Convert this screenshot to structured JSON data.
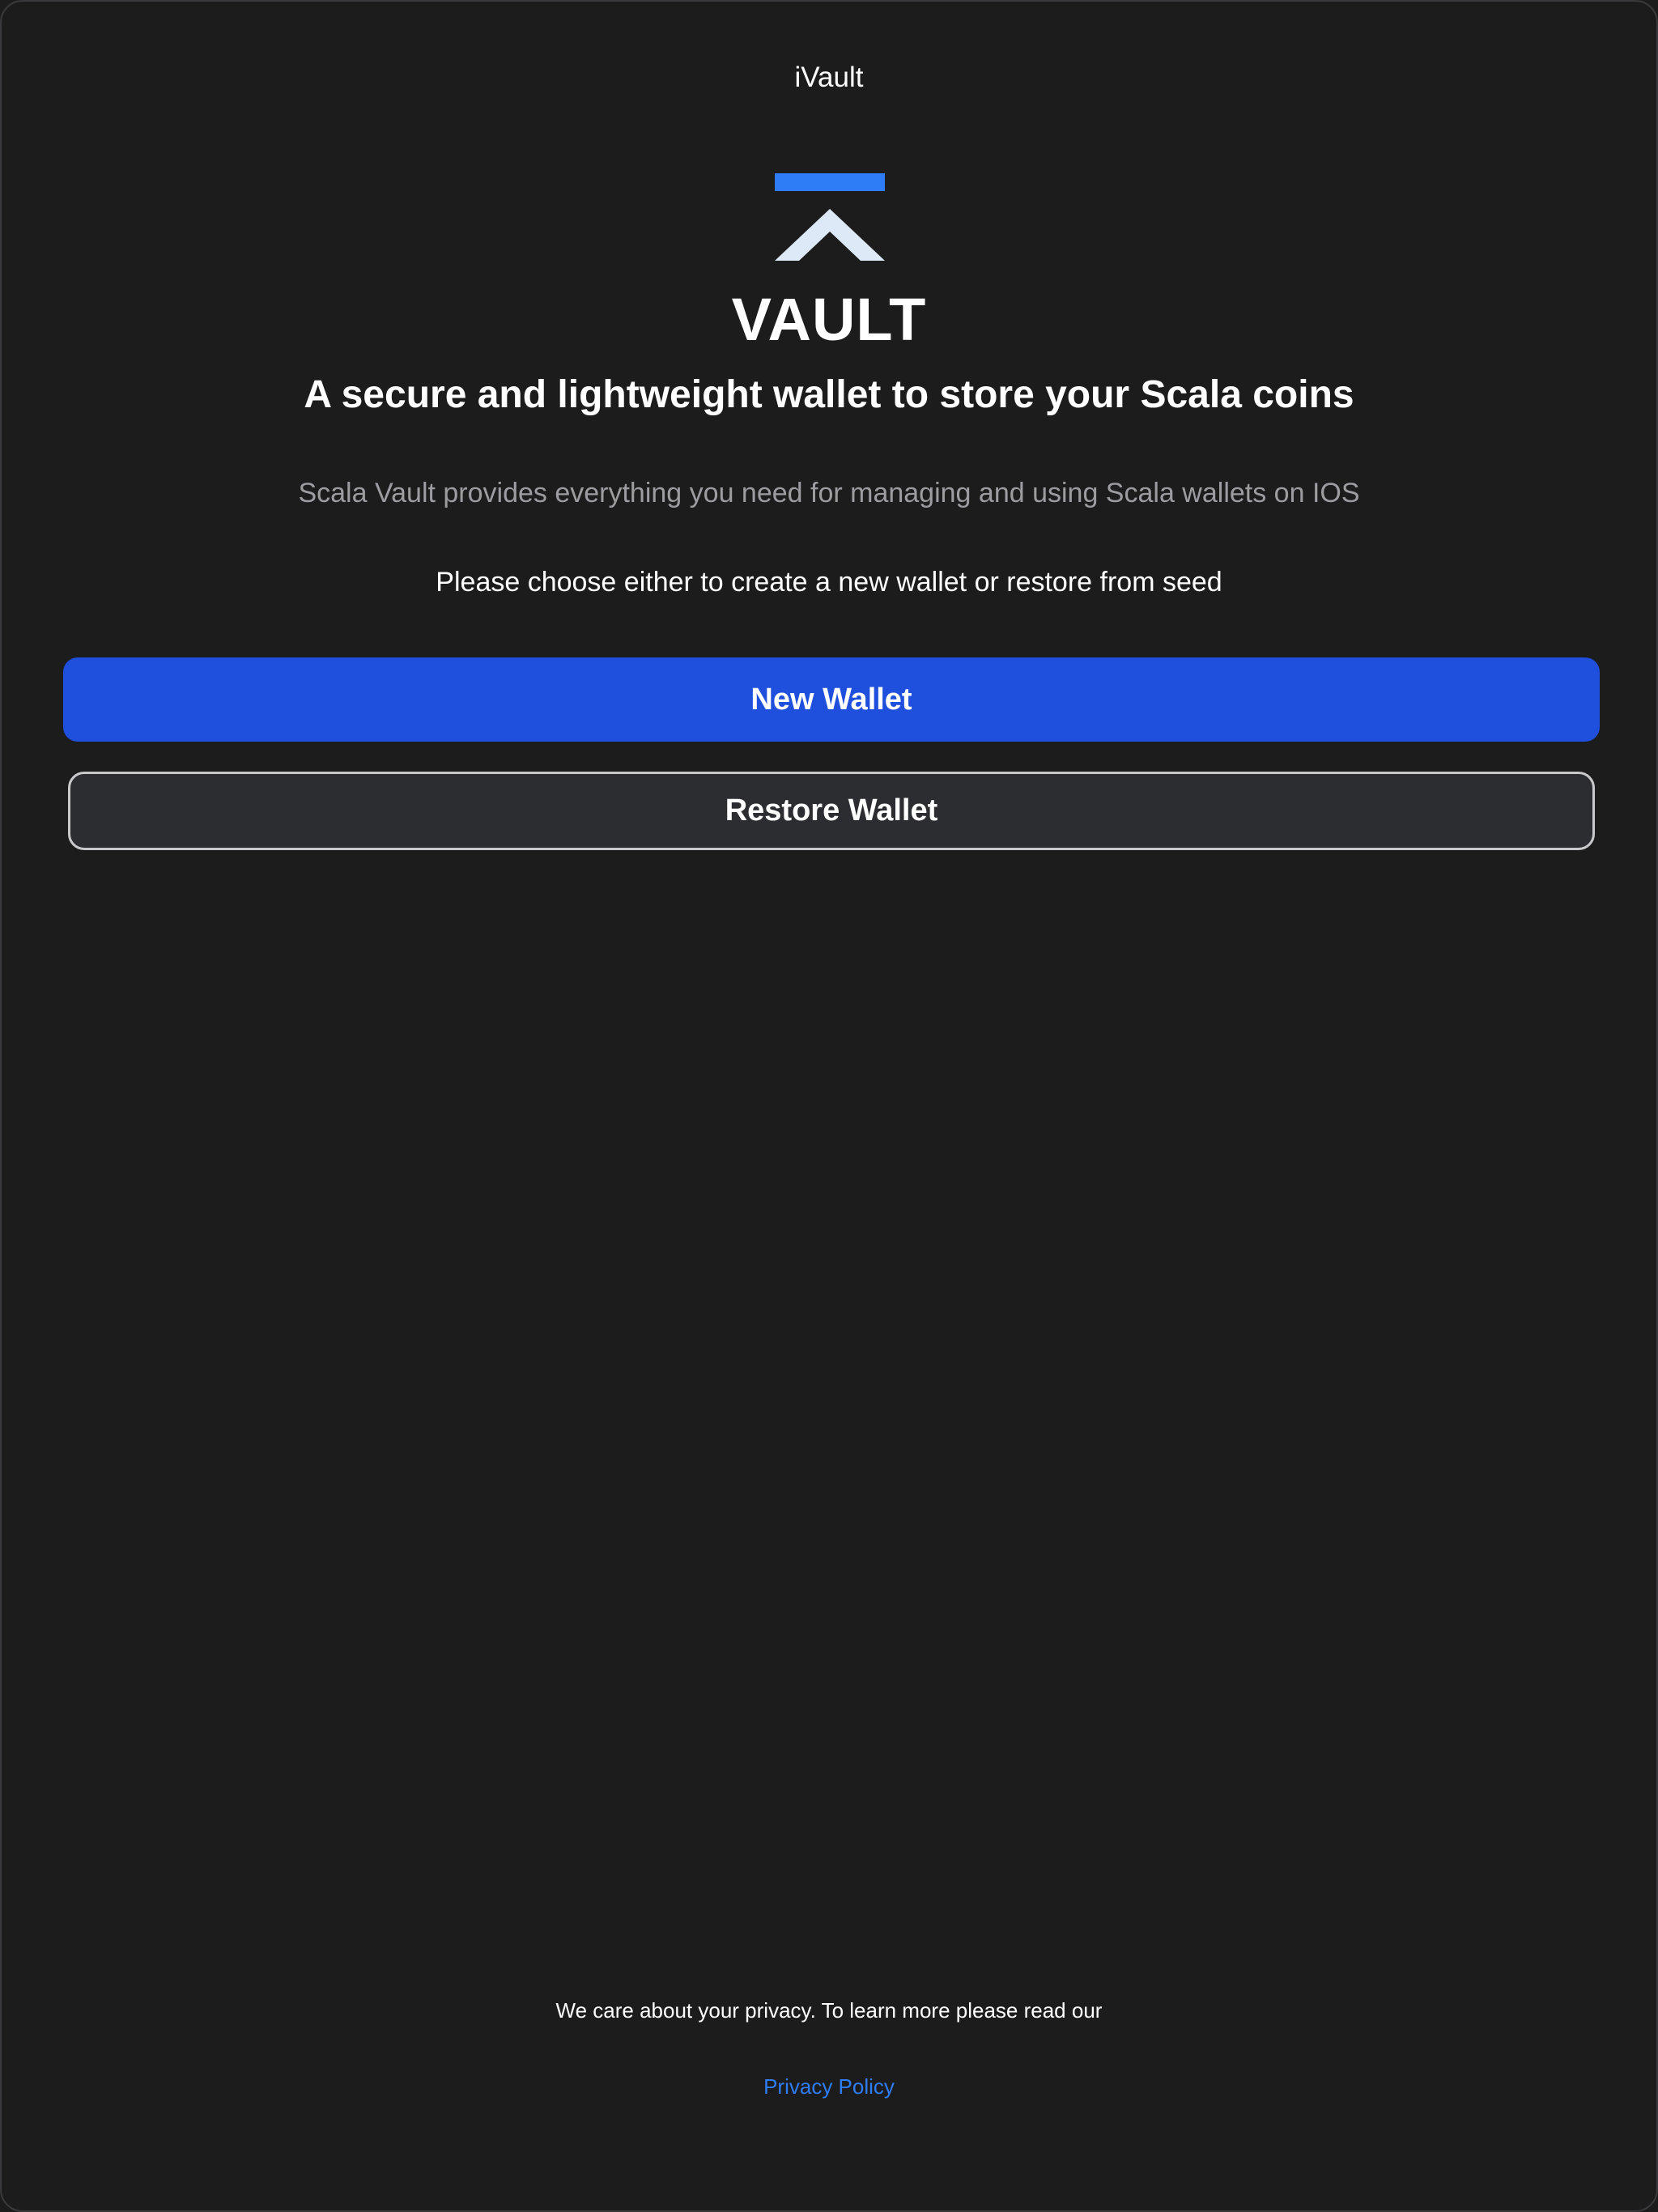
{
  "app": {
    "title": "iVault"
  },
  "brand": {
    "name": "VAULT",
    "logo_icon": "vault-chevron-logo-icon",
    "logo_bar_color": "#2f7df6",
    "logo_chevron_color": "#dde9f6"
  },
  "content": {
    "headline": "A secure and lightweight wallet to store your Scala coins",
    "description": "Scala Vault provides everything you need for managing and using Scala wallets on IOS",
    "instruction": "Please choose either to create a new wallet or restore from seed"
  },
  "actions": {
    "new_wallet_label": "New Wallet",
    "restore_wallet_label": "Restore Wallet",
    "primary_color": "#1f4fdd"
  },
  "footer": {
    "privacy_text": "We care about your privacy. To learn more please read our",
    "privacy_link": "Privacy Policy",
    "link_color": "#2f7df6"
  }
}
